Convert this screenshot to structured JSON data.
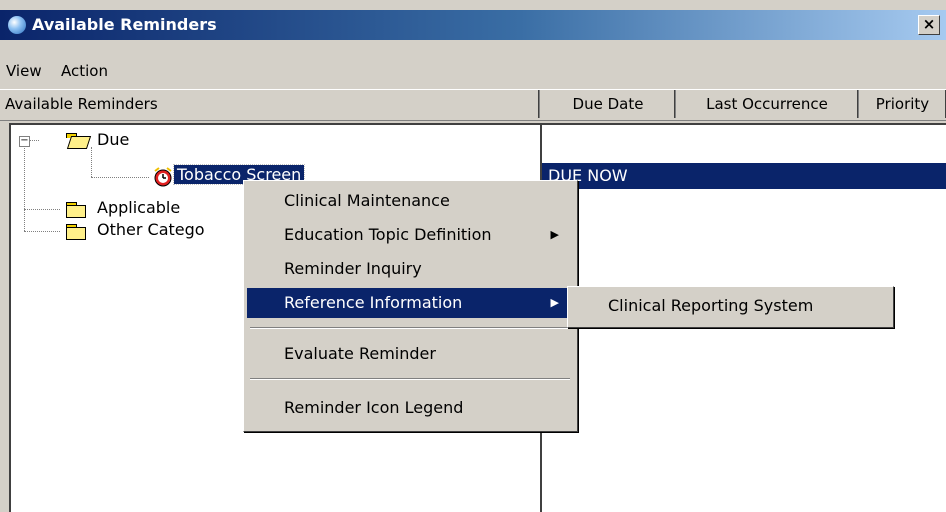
{
  "window": {
    "title": "Available Reminders",
    "close_glyph": "×"
  },
  "menubar": {
    "items": [
      "View",
      "Action"
    ]
  },
  "columns": {
    "left_header": "Available Reminders",
    "due_date": "Due Date",
    "last_occurrence": "Last Occurrence",
    "priority": "Priority"
  },
  "tree": {
    "expander_glyph": "−",
    "due": "Due",
    "tobacco": "Tobacco Screen",
    "applicable": "Applicable",
    "other": "Other Catego"
  },
  "right_list": {
    "due_status": "DUE NOW"
  },
  "context_menu": {
    "items": [
      "Clinical Maintenance",
      "Education Topic Definition",
      "Reminder Inquiry",
      "Reference Information",
      "Evaluate Reminder",
      "Reminder Icon Legend"
    ],
    "arrow_glyph": "▶"
  },
  "submenu": {
    "items": [
      "Clinical Reporting System"
    ]
  },
  "icons": [
    "window-globe-icon",
    "close-icon",
    "folder-open-icon",
    "folder-icon",
    "alarm-clock-icon",
    "submenu-arrow-icon"
  ],
  "colors": {
    "selection": "#0a246a",
    "face": "#d4d0c8",
    "title_start": "#0a246a",
    "title_end": "#a6caf0"
  }
}
